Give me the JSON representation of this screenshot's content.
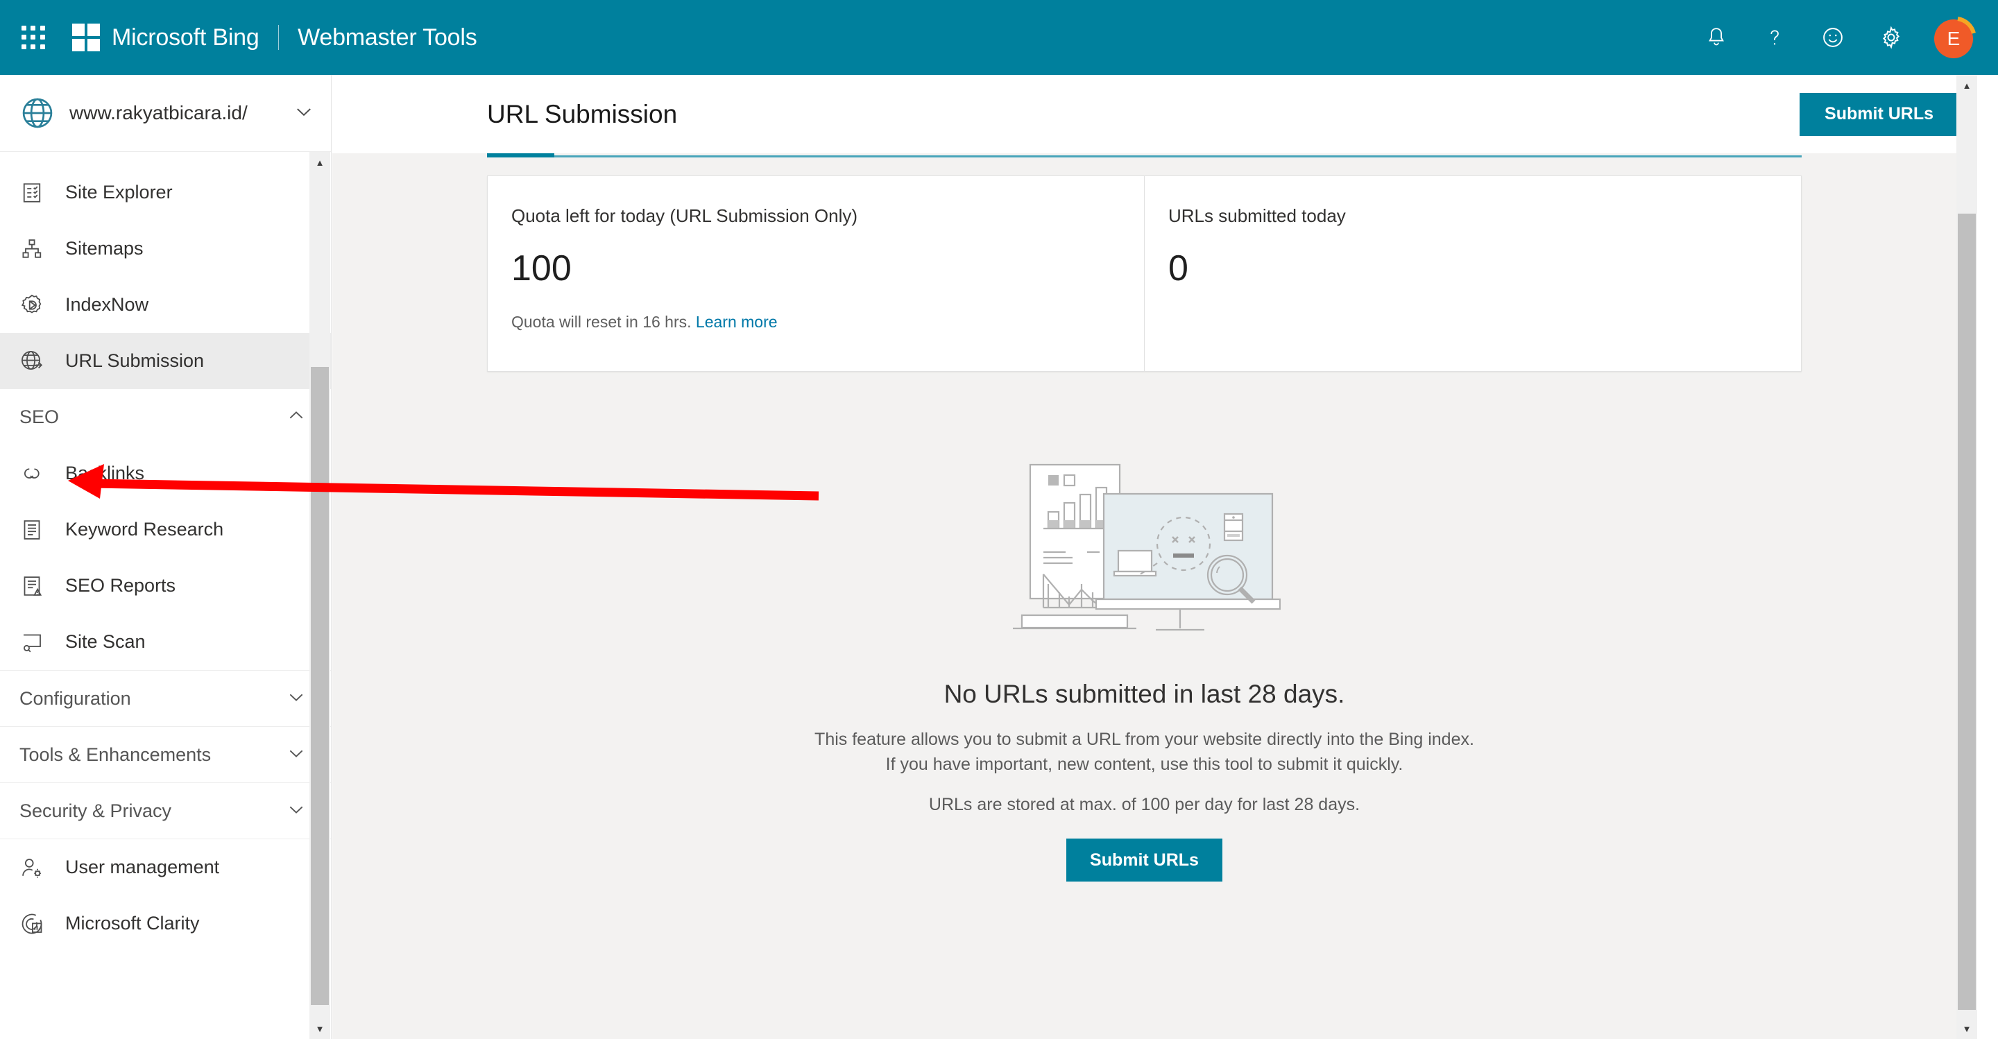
{
  "topbar": {
    "waffle_label": "App launcher",
    "brand": "Microsoft Bing",
    "separator": "|",
    "suite": "Webmaster Tools",
    "icons": [
      "bell-icon",
      "question-icon",
      "smiley-icon",
      "gear-icon"
    ],
    "avatar_initial": "E",
    "accent_color": "#00809d",
    "avatar_color": "#f05a28",
    "avatar_ring_color": "#f5a623"
  },
  "sidebar": {
    "site_url": "www.rakyatbicara.id/",
    "site_picker_caret": "chevron-down-icon",
    "items": [
      {
        "label": "Site Explorer",
        "icon": "site-explorer-icon",
        "active": false
      },
      {
        "label": "Sitemaps",
        "icon": "sitemaps-icon",
        "active": false
      },
      {
        "label": "IndexNow",
        "icon": "indexnow-icon",
        "active": false
      },
      {
        "label": "URL Submission",
        "icon": "url-submission-icon",
        "active": true
      }
    ],
    "seo_group": {
      "label": "SEO",
      "caret": "chevron-up-icon",
      "expanded": true
    },
    "seo_items": [
      {
        "label": "Backlinks",
        "icon": "backlinks-icon"
      },
      {
        "label": "Keyword Research",
        "icon": "keyword-research-icon"
      },
      {
        "label": "SEO Reports",
        "icon": "seo-reports-icon"
      },
      {
        "label": "Site Scan",
        "icon": "site-scan-icon"
      }
    ],
    "collapsed_groups": [
      {
        "label": "Configuration",
        "caret": "chevron-down-icon"
      },
      {
        "label": "Tools & Enhancements",
        "caret": "chevron-down-icon"
      },
      {
        "label": "Security & Privacy",
        "caret": "chevron-down-icon"
      }
    ],
    "bottom_items": [
      {
        "label": "User management",
        "icon": "user-management-icon"
      },
      {
        "label": "Microsoft Clarity",
        "icon": "microsoft-clarity-icon"
      }
    ]
  },
  "main": {
    "page_title": "URL Submission",
    "submit_button": "Submit URLs",
    "stats": [
      {
        "title": "Quota left for today (URL Submission Only)",
        "value": "100",
        "sub_text": "Quota will reset in 16 hrs.",
        "sub_link": "Learn more"
      },
      {
        "title": "URLs submitted today",
        "value": "0",
        "sub_text": "",
        "sub_link": ""
      }
    ],
    "empty_state": {
      "illustration": "no-data-illustration",
      "heading": "No URLs submitted in last 28 days.",
      "line1": "This feature allows you to submit a URL from your website directly into the Bing index.",
      "line2": "If you have important, new content, use this tool to submit it quickly.",
      "line3": "URLs are stored at max. of 100 per day for last 28 days.",
      "button": "Submit URLs"
    }
  },
  "annotation": {
    "type": "arrow",
    "color": "#ff0000",
    "points_to": "SEO"
  }
}
